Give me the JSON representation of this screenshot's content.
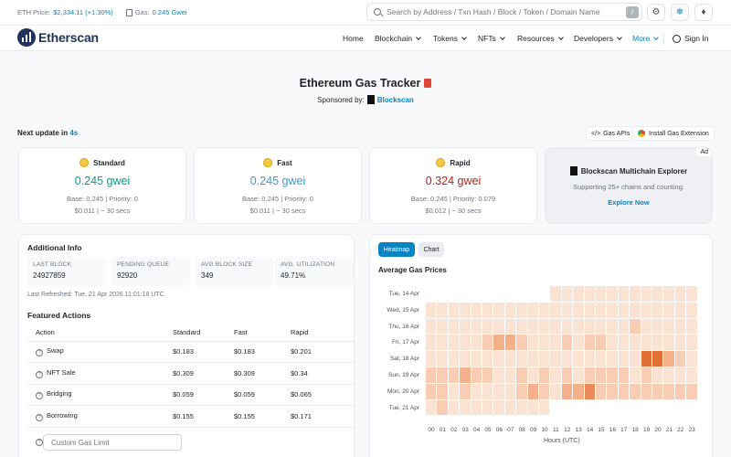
{
  "topbar": {
    "eth_price_label": "ETH Price:",
    "eth_price_value": "$2,334.11 (+1.30%)",
    "gas_label": "Gas:",
    "gas_value": "0.245 Gwei",
    "search_placeholder": "Search by Address / Txn Hash / Block / Token / Domain Name",
    "search_shortcut": "/",
    "icons": [
      "settings-icon",
      "ethereum-network-icon",
      "ethereum-logo-icon"
    ]
  },
  "nav": {
    "brand": "Etherscan",
    "items": [
      {
        "label": "Home"
      },
      {
        "label": "Blockchain"
      },
      {
        "label": "Tokens"
      },
      {
        "label": "NFTs"
      },
      {
        "label": "Resources"
      },
      {
        "label": "Developers"
      },
      {
        "label": "More"
      }
    ],
    "signin": "Sign In"
  },
  "hero": {
    "title": "Ethereum Gas Tracker",
    "sponsored_by": "Sponsored by:",
    "sponsor": "Blockscan"
  },
  "update": {
    "label": "Next update in",
    "seconds": "4s",
    "gas_apis": "Gas APIs",
    "install_ext": "Install Gas Extension"
  },
  "cards": [
    {
      "name": "Standard",
      "price": "0.245 gwei",
      "base": "Base: 0.245 | Priority: 0",
      "usd": "$0.011 | ~ 30 secs",
      "color": "#00a186"
    },
    {
      "name": "Fast",
      "price": "0.245 gwei",
      "base": "Base: 0.245 | Priority: 0",
      "usd": "$0.011 | ~ 30 secs",
      "color": "#3498db"
    },
    {
      "name": "Rapid",
      "price": "0.324 gwei",
      "base": "Base: 0.245 | Priority: 0.079",
      "usd": "$0.012 | ~ 30 secs",
      "color": "#b6251d"
    }
  ],
  "ad": {
    "tag": "Ad",
    "title": "Blockscan Multichain Explorer",
    "desc": "Supporting 25+ chains and counting.",
    "link": "Explore Now"
  },
  "additional": {
    "title": "Additional Info",
    "stats": [
      {
        "key": "LAST BLOCK",
        "value": "24927859"
      },
      {
        "key": "PENDING QUEUE",
        "value": "92920"
      },
      {
        "key": "AVG BLOCK SIZE",
        "value": "349"
      },
      {
        "key": "AVG. UTILIZATION",
        "value": "49.71%"
      }
    ],
    "refreshed": "Last Refreshed: Tue, 21 Apr 2026 11:01:18 UTC"
  },
  "featured": {
    "title": "Featured Actions",
    "headers": [
      "Action",
      "Standard",
      "Fast",
      "Rapid"
    ],
    "rows": [
      [
        "Swap",
        "$0.183",
        "$0.183",
        "$0.201"
      ],
      [
        "NFT Sale",
        "$0.309",
        "$0.309",
        "$0.34"
      ],
      [
        "Bridging",
        "$0.059",
        "$0.059",
        "$0.065"
      ],
      [
        "Borrowing",
        "$0.155",
        "$0.155",
        "$0.171"
      ]
    ],
    "custom_gas_placeholder": "Custom Gas Limit"
  },
  "chart_tabs": {
    "heatmap": "Heatmap",
    "chart": "Chart"
  },
  "chart_data": {
    "type": "heatmap",
    "title": "Average Gas Prices",
    "xlabel": "Hours (UTC)",
    "ylabel": "",
    "y_categories": [
      "Tue, 14 Apr",
      "Wed, 15 Apr",
      "Thu, 16 Apr",
      "Fri, 17 Apr",
      "Sat, 18 Apr",
      "Sun, 19 Apr",
      "Mon, 20 Apr",
      "Tue, 21 Apr"
    ],
    "x_categories": [
      "00",
      "01",
      "02",
      "03",
      "04",
      "05",
      "06",
      "07",
      "08",
      "09",
      "10",
      "11",
      "12",
      "13",
      "14",
      "15",
      "16",
      "17",
      "18",
      "19",
      "20",
      "21",
      "22",
      "23"
    ],
    "intensity_scale": "0 = lightest, 5 = darkest; null = no data",
    "values": [
      [
        null,
        null,
        null,
        null,
        null,
        null,
        null,
        null,
        null,
        null,
        null,
        1,
        1,
        1,
        1,
        1,
        1,
        1,
        1,
        1,
        1,
        1,
        1,
        1
      ],
      [
        1,
        1,
        1,
        1,
        1,
        1,
        1,
        1,
        1,
        1,
        1,
        1,
        1,
        1,
        1,
        1,
        1,
        1,
        1,
        1,
        1,
        1,
        1,
        1
      ],
      [
        1,
        1,
        1,
        1,
        1,
        1,
        1,
        1,
        1,
        1,
        1,
        1,
        1,
        1,
        1,
        1,
        1,
        1,
        2,
        1,
        1,
        1,
        1,
        1
      ],
      [
        1,
        1,
        1,
        1,
        1,
        2,
        3,
        3,
        2,
        1,
        1,
        1,
        2,
        1,
        2,
        2,
        1,
        1,
        1,
        1,
        1,
        1,
        1,
        1
      ],
      [
        1,
        1,
        1,
        1,
        1,
        1,
        1,
        1,
        1,
        1,
        1,
        1,
        1,
        1,
        1,
        1,
        1,
        1,
        1,
        5,
        5,
        3,
        2,
        1
      ],
      [
        2,
        2,
        2,
        3,
        2,
        2,
        1,
        1,
        2,
        1,
        2,
        1,
        2,
        1,
        2,
        2,
        2,
        2,
        1,
        2,
        1,
        1,
        1,
        1
      ],
      [
        2,
        2,
        1,
        2,
        1,
        1,
        1,
        1,
        2,
        3,
        2,
        1,
        3,
        3,
        4,
        2,
        2,
        2,
        2,
        2,
        2,
        2,
        2,
        2
      ],
      [
        1,
        2,
        1,
        1,
        1,
        1,
        1,
        1,
        1,
        1,
        1,
        null,
        null,
        null,
        null,
        null,
        null,
        null,
        null,
        null,
        null,
        null,
        null,
        null
      ]
    ],
    "colors": [
      "#fdf3ec",
      "#fbe3d3",
      "#f8cdb3",
      "#f3b089",
      "#ea8a5a",
      "#e07036"
    ]
  }
}
